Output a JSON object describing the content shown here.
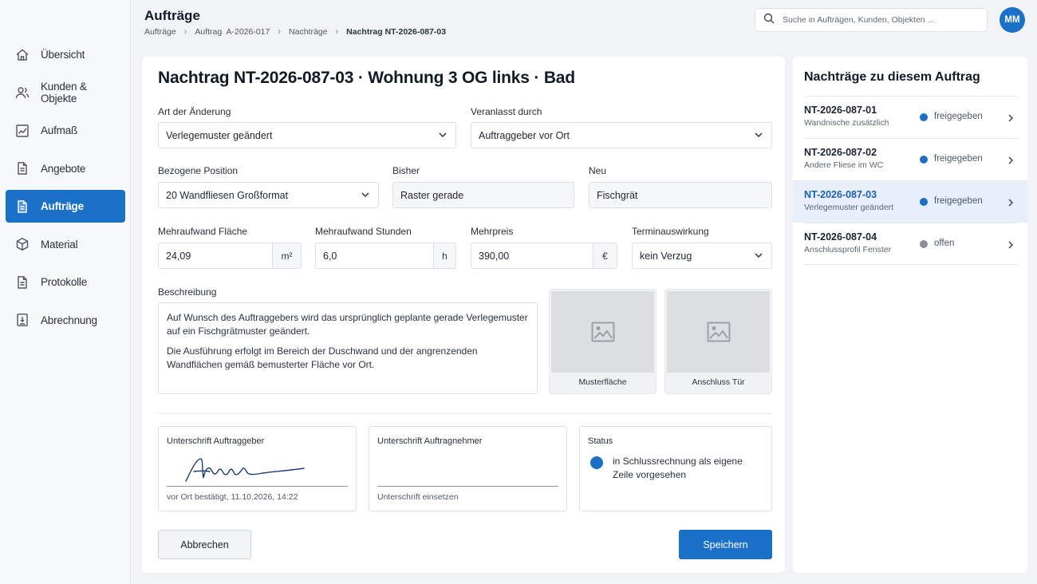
{
  "header": {
    "title": "Aufträge",
    "breadcrumb": [
      "Aufträge",
      "Auftrag  A-2026-017",
      "Nachträge",
      "Nachtrag NT-2026-087-03"
    ],
    "search_placeholder": "Suche in Aufträgen, Kunden, Objekten ...",
    "avatar_initials": "MM"
  },
  "sidebar": {
    "items": [
      {
        "label": "Übersicht",
        "icon": "home-icon"
      },
      {
        "label": "Kunden & Objekte",
        "icon": "users-icon"
      },
      {
        "label": "Aufmaß",
        "icon": "chart-icon"
      },
      {
        "label": "Angebote",
        "icon": "document-icon"
      },
      {
        "label": "Aufträge",
        "icon": "document-filled-icon",
        "active": true
      },
      {
        "label": "Material",
        "icon": "box-icon"
      },
      {
        "label": "Protokolle",
        "icon": "document-icon"
      },
      {
        "label": "Abrechnung",
        "icon": "invoice-icon"
      }
    ]
  },
  "form": {
    "title": "Nachtrag NT-2026-087-03 · Wohnung 3 OG links · Bad",
    "art_label": "Art der Änderung",
    "art_value": "Verlegemuster geändert",
    "veranlasst_label": "Veranlasst durch",
    "veranlasst_value": "Auftraggeber vor Ort",
    "position_label": "Bezogene Position",
    "position_value": "20 Wandfliesen Großformat",
    "bisher_label": "Bisher",
    "bisher_value": "Raster gerade",
    "neu_label": "Neu",
    "neu_value": "Fischgrät",
    "flaeche_label": "Mehraufwand Fläche",
    "flaeche_value": "24,09",
    "flaeche_unit": "m²",
    "stunden_label": "Mehraufwand Stunden",
    "stunden_value": "6,0",
    "stunden_unit": "h",
    "preis_label": "Mehrpreis",
    "preis_value": "390,00",
    "preis_unit": "€",
    "termin_label": "Terminauswirkung",
    "termin_value": "kein Verzug",
    "beschreibung_label": "Beschreibung",
    "beschreibung_p1": "Auf Wunsch des Auftraggebers wird das ursprünglich geplante gerade Verlegemuster auf ein Fischgrätmuster geändert.",
    "beschreibung_p2": "Die Ausführung erfolgt im Bereich der Duschwand und der angrenzenden Wandflächen gemäß bemusterter Fläche vor Ort.",
    "photo1_caption": "Musterfläche",
    "photo2_caption": "Anschluss Tür",
    "sig_ag_label": "Unterschrift Auftraggeber",
    "sig_ag_sub": "vor Ort bestätigt, 11.10.2026, 14:22",
    "sig_an_label": "Unterschrift Auftragnehmer",
    "sig_an_sub": "Unterschrift einsetzen",
    "status_label": "Status",
    "status_text": "in Schlussrechnung als eigene Zeile vorgesehen",
    "cancel_label": "Abbrechen",
    "save_label": "Speichern"
  },
  "panel": {
    "title": "Nachträge zu diesem Auftrag",
    "items": [
      {
        "id": "NT-2026-087-01",
        "sub": "Wandnische zusätzlich",
        "status": "freigegeben",
        "color": "#1b70c7"
      },
      {
        "id": "NT-2026-087-02",
        "sub": "Andere Fliese im WC",
        "status": "freigegeben",
        "color": "#1b70c7"
      },
      {
        "id": "NT-2026-087-03",
        "sub": "Verlegemuster geändert",
        "status": "freigegeben",
        "color": "#1b70c7",
        "selected": true
      },
      {
        "id": "NT-2026-087-04",
        "sub": "Anschlussprofil Fenster",
        "status": "offen",
        "color": "#8a8f96"
      }
    ]
  },
  "colors": {
    "accent": "#1b70c7",
    "selected_bg": "#e6effa",
    "offen": "#8a8f96"
  }
}
